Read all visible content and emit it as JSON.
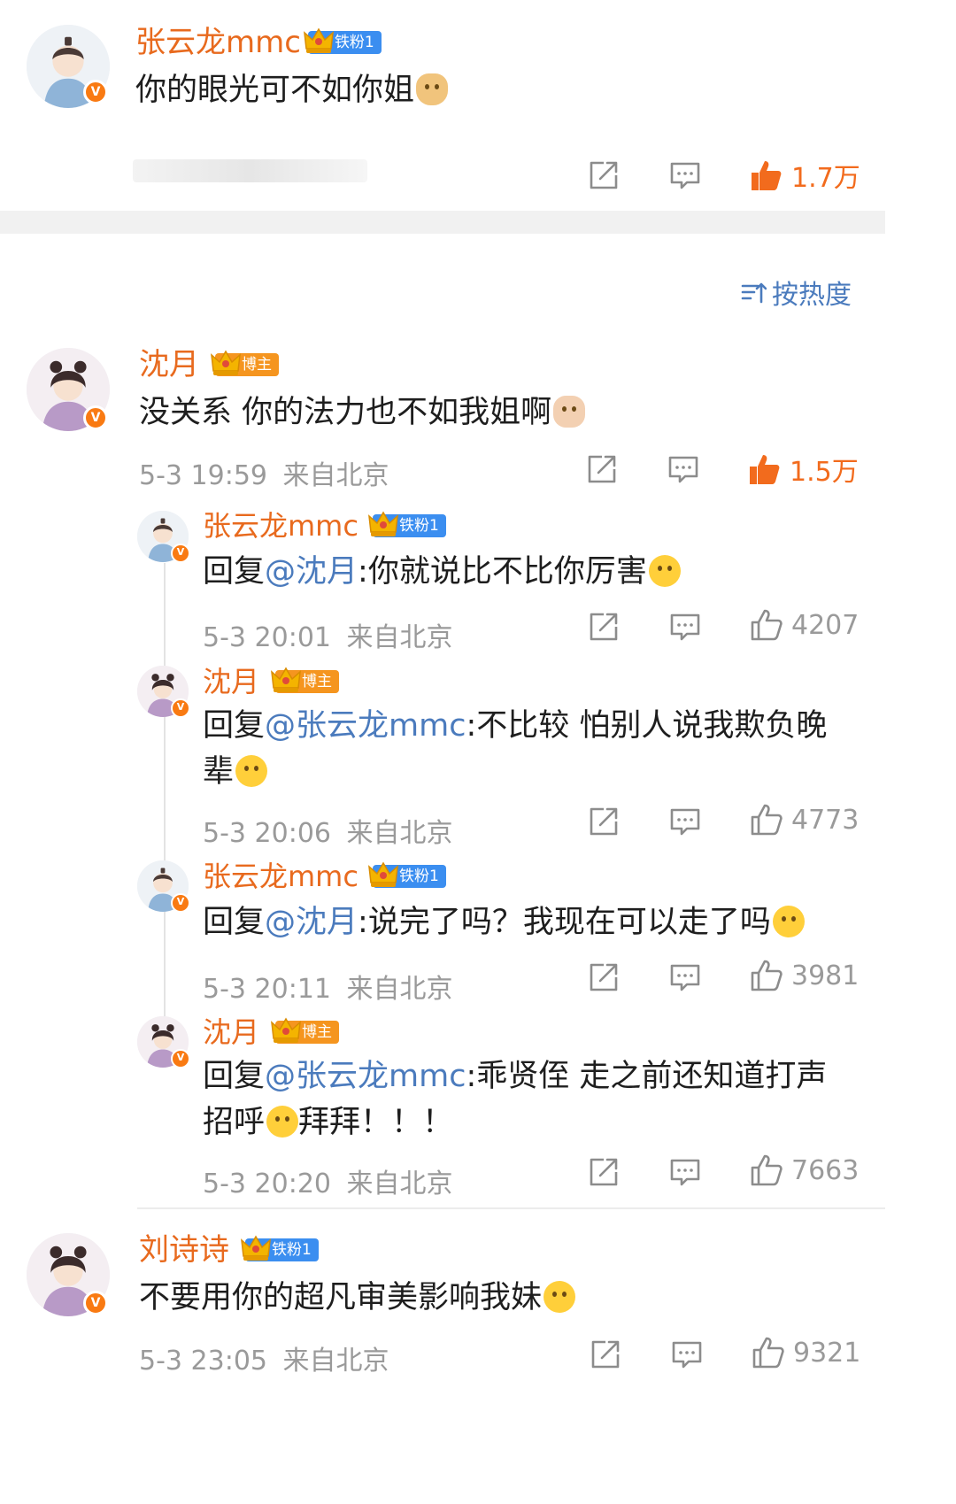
{
  "top": {
    "user": "张云龙mmc",
    "badge": "铁粉1",
    "text": "你的眼光可不如你姐",
    "likes": "1.7万"
  },
  "sort_label": "按热度",
  "comments": [
    {
      "user": "沈月",
      "badge": "博主",
      "text": "没关系 你的法力也不如我姐啊",
      "time": "5-3 19:59",
      "location": "来自北京",
      "likes": "1.5万",
      "replies": [
        {
          "user": "张云龙mmc",
          "badge": "铁粉1",
          "prefix": "回复",
          "mention": "@沈月",
          "text": ":你就说比不比你厉害",
          "time": "5-3 20:01",
          "location": "来自北京",
          "likes": "4207"
        },
        {
          "user": "沈月",
          "badge": "博主",
          "prefix": "回复",
          "mention": "@张云龙mmc",
          "text": ":不比较 怕别人说我欺负晚辈",
          "time": "5-3 20:06",
          "location": "来自北京",
          "likes": "4773"
        },
        {
          "user": "张云龙mmc",
          "badge": "铁粉1",
          "prefix": "回复",
          "mention": "@沈月",
          "text": ":说完了吗？我现在可以走了吗",
          "time": "5-3 20:11",
          "location": "来自北京",
          "likes": "3981"
        },
        {
          "user": "沈月",
          "badge": "博主",
          "prefix": "回复",
          "mention": "@张云龙mmc",
          "text": ":乖贤侄 走之前还知道打声招呼",
          "text2": "拜拜！！！",
          "time": "5-3 20:20",
          "location": "来自北京",
          "likes": "7663"
        }
      ]
    },
    {
      "user": "刘诗诗",
      "badge": "铁粉1",
      "text": "不要用你的超凡审美影响我妹",
      "time": "5-3 23:05",
      "location": "来自北京",
      "likes": "9321"
    }
  ],
  "icons": {
    "share": "share-icon",
    "comment": "comment-icon",
    "like": "like-icon",
    "sort": "sort-icon",
    "verified": "verified-badge-icon",
    "crown": "crown-icon"
  },
  "colors": {
    "username": "#e86a1e",
    "mention": "#4b7bbd",
    "hot_like": "#f26b1d",
    "fan_badge": "#3b8ef0",
    "host_badge": "#f5951f"
  }
}
